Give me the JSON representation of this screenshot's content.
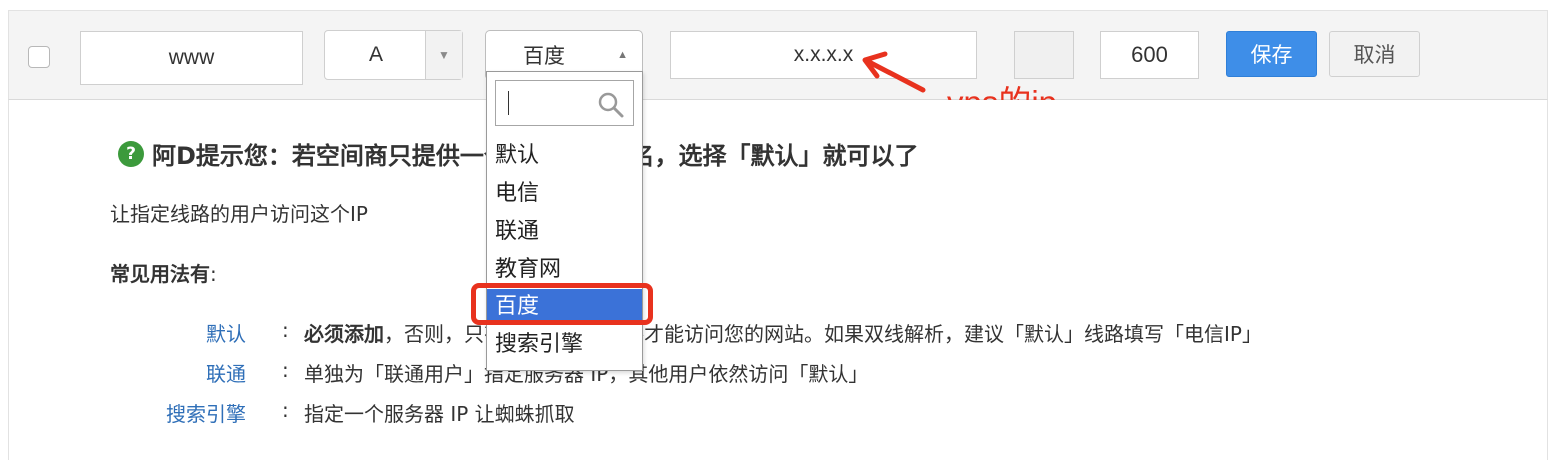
{
  "record": {
    "host": "www",
    "type": "A",
    "line": "百度",
    "value": "x.x.x.x",
    "mx": "",
    "ttl": "600",
    "save_label": "保存",
    "cancel_label": "取消"
  },
  "annotation": {
    "text": "vps的ip",
    "color": "#e8321e"
  },
  "dropdown": {
    "search_value": "",
    "items": [
      "默认",
      "电信",
      "联通",
      "教育网",
      "百度",
      "搜索引擎"
    ],
    "selected": "百度",
    "highlight_color": "#3b72d8"
  },
  "tip": {
    "title": "阿D提示您：若空间商只提供一个IP地址或域名，选择「默认」就可以了",
    "description": "让指定线路的用户访问这个IP",
    "usage_title": "常见用法有",
    "usage_colon": ":",
    "rows": [
      {
        "key": "默认",
        "sep": ":",
        "text_bold": "必须添加",
        "text": "，否则，只有单独指定的线路才能访问您的网站。如果双线解析，建议「默认」线路填写「电信IP」"
      },
      {
        "key": "联通",
        "sep": ":",
        "text_bold": "",
        "text": "单独为「联通用户」指定服务器 IP，其他用户依然访问「默认」"
      },
      {
        "key": "搜索引擎",
        "sep": ":",
        "text_bold": "",
        "text": "指定一个服务器 IP 让蜘蛛抓取"
      }
    ]
  },
  "colors": {
    "accent": "#3e8ee8",
    "link": "#2f6fb8",
    "tip_icon": "#3c9a3c"
  }
}
